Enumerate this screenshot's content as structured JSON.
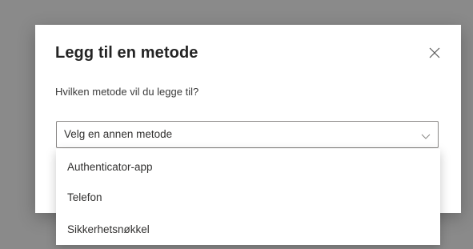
{
  "dialog": {
    "title": "Legg til en metode",
    "subtitle": "Hvilken metode vil du legge til?",
    "close_icon": "close-icon"
  },
  "method_select": {
    "selected_value": "Velg en annen metode",
    "chevron_icon": "chevron-down-icon",
    "options": [
      {
        "label": "Authenticator-app"
      },
      {
        "label": "Telefon"
      },
      {
        "label": "Sikkerhetsnøkkel"
      }
    ]
  },
  "colors": {
    "overlay": "#8a8a8a",
    "dialog_bg": "#ffffff",
    "text_primary": "#242424",
    "border": "#8a8886"
  }
}
